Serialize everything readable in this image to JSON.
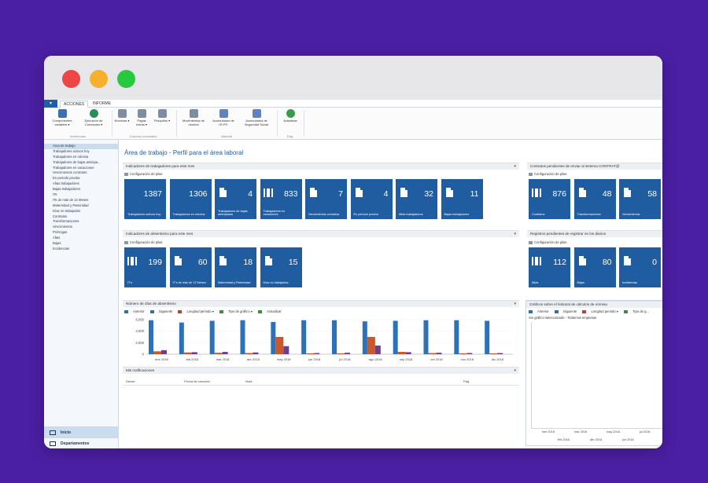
{
  "ribbon": {
    "tabs": [
      "ACCIONES",
      "INFORME"
    ],
    "buttons": [
      {
        "label": "Componentes variables ▾",
        "icon": "grid-icon"
      },
      {
        "label": "Ejecución de Conceptos ▾",
        "icon": "globe-icon"
      },
      {
        "label": "Nóminas ▾",
        "icon": "table-icon"
      },
      {
        "label": "Pagas extras ▾",
        "icon": "table-icon"
      },
      {
        "label": "Finiquitos ▾",
        "icon": "table-icon"
      },
      {
        "label": "Movimientos de nómina",
        "icon": "table-icon"
      },
      {
        "label": "Acumulados de I.R.P.F.",
        "icon": "users-icon"
      },
      {
        "label": "Acumulados de Seguridad Social",
        "icon": "users-icon"
      },
      {
        "label": "Actualizar",
        "icon": "refresh-icon"
      }
    ],
    "groups": [
      "Incidencias",
      "Cálculos nominales",
      "Historial",
      "Pág."
    ]
  },
  "nav": {
    "items": [
      "Área de trabajo",
      "Trabajadores activos hoy",
      "Trabajadores en nómina",
      "Trabajadores de bajas anticipa...",
      "Trabajadores en vacaciones",
      "Vencimientos contratos",
      "En periodo prueba",
      "Altas trabajadores",
      "Bajas trabajadores",
      "ITs",
      "ITs de más de 12 Meses",
      "Maternidad y Paternidad",
      "Días no trabajados",
      "Contratos",
      "Transformaciones",
      "Vencimientos",
      "Prórrogas",
      "Altas",
      "Bajas",
      "Incidencias"
    ],
    "bottom": [
      "Inicio",
      "Departamentos"
    ]
  },
  "main": {
    "title": "Área de trabajo - Perfil para el área laboral",
    "config_label": "Configuración de pilas",
    "sections": {
      "workers": "Indicadores de trabajadores para este mes",
      "absence": "Indicadores de absentismo para este mes",
      "contracts": "Contratos pendientes de enviar al sistema CONTRAT@",
      "registry": "Registros pendientes de registrar en los diarios",
      "chart": "Número de días de absentismo",
      "history": "Gráficos sobre el historial de cálculos de nómina",
      "notifications": "Mis notificaciones"
    },
    "worker_tiles": [
      {
        "value": "1387",
        "label": "Trabajadores activos hoy",
        "icon": "none"
      },
      {
        "value": "1306",
        "label": "Trabajadores en nómina",
        "icon": "none"
      },
      {
        "value": "4",
        "label": "Trabajadores de bajas anticipadas",
        "icon": "document-icon"
      },
      {
        "value": "833",
        "label": "Trabajadores en vacaciones",
        "icon": "documents-icon"
      },
      {
        "value": "7",
        "label": "Vencimientos contratos",
        "icon": "document-icon"
      },
      {
        "value": "4",
        "label": "En periodo prueba",
        "icon": "document-icon"
      },
      {
        "value": "32",
        "label": "Altas trabajadores",
        "icon": "document-icon"
      },
      {
        "value": "11",
        "label": "Bajas trabajadores",
        "icon": "document-icon"
      }
    ],
    "contract_tiles": [
      {
        "value": "876",
        "label": "Contratos",
        "icon": "documents-icon"
      },
      {
        "value": "48",
        "label": "Transformaciones",
        "icon": "document-icon"
      },
      {
        "value": "58",
        "label": "Vencimientos",
        "icon": "document-icon"
      }
    ],
    "absence_tiles": [
      {
        "value": "199",
        "label": "IT's",
        "icon": "documents-icon"
      },
      {
        "value": "60",
        "label": "IT's de más de 12 Meses",
        "icon": "document-icon"
      },
      {
        "value": "18",
        "label": "Maternidad y Paternidad",
        "icon": "document-icon"
      },
      {
        "value": "15",
        "label": "Días no trabajados",
        "icon": "document-icon"
      }
    ],
    "registry_tiles": [
      {
        "value": "112",
        "label": "Altas",
        "icon": "documents-icon"
      },
      {
        "value": "80",
        "label": "Bajas",
        "icon": "document-icon"
      },
      {
        "value": "0",
        "label": "Incidencias",
        "icon": "document-icon"
      }
    ],
    "chart_toolbar": [
      "Anterior",
      "Siguiente",
      "Longitud periodo ▾",
      "Tipo de gráfico ▾",
      "Actualizar"
    ],
    "history_toolbar": [
      "Anterior",
      "Siguiente",
      "Longitud periodo ▾",
      "Tipo de g..."
    ],
    "history_subtitle": "Sin gráfico seleccionado - Todas las empresas",
    "history_xlabels": [
      "ene 2018",
      "mar 2018",
      "may 2018",
      "jul 2018"
    ],
    "history_xlabels2": [
      "feb 2018",
      "abr 2018",
      "jun 2018"
    ],
    "notif_headers": [
      "Desde",
      "Fecha de creación",
      "Nota",
      "Pág."
    ]
  },
  "chart_data": {
    "type": "bar",
    "categories": [
      "ene 2018",
      "feb 2018",
      "mar 2018",
      "abr 2018",
      "may 2018",
      "jun 2018",
      "jul 2018",
      "ago 2018",
      "sep 2018",
      "oct 2018",
      "nov 2018",
      "dic 2018"
    ],
    "ylim": [
      0,
      6000
    ],
    "yticks": [
      "6,000",
      "4,000",
      "2,000",
      "0"
    ],
    "series": [
      {
        "values": [
          5900,
          5500,
          5800,
          5900,
          5600,
          5900,
          5900,
          5700,
          5800,
          5900,
          5900,
          5800
        ],
        "color": "#2b72b9"
      },
      {
        "values": [
          500,
          300,
          250,
          200,
          3000,
          150,
          150,
          3000,
          400,
          200,
          150,
          150
        ],
        "color": "#c9582a"
      },
      {
        "values": [
          700,
          350,
          400,
          300,
          1400,
          200,
          250,
          1500,
          350,
          250,
          200,
          200
        ],
        "color": "#6b3f8f"
      }
    ]
  }
}
